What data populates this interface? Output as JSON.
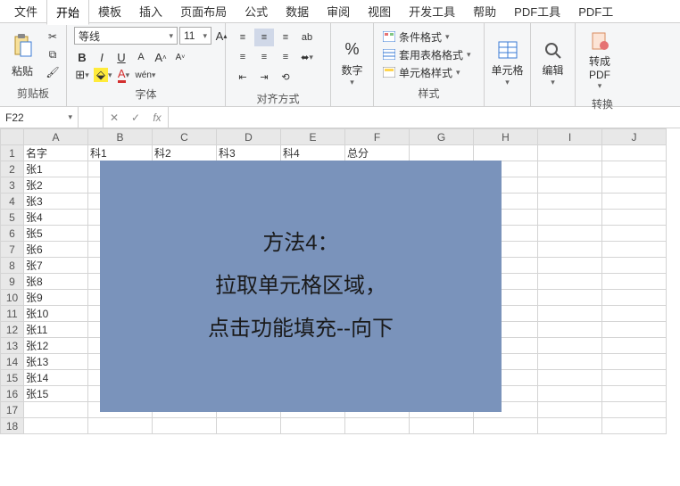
{
  "menu": {
    "items": [
      "文件",
      "开始",
      "模板",
      "插入",
      "页面布局",
      "公式",
      "数据",
      "审阅",
      "视图",
      "开发工具",
      "帮助",
      "PDF工具",
      "PDF工"
    ],
    "active": 1
  },
  "ribbon": {
    "clipboard": {
      "paste": "粘贴",
      "label": "剪贴板"
    },
    "font": {
      "name": "等线",
      "size": "11",
      "label": "字体"
    },
    "align": {
      "label": "对齐方式"
    },
    "number": {
      "btn": "数字",
      "label": ""
    },
    "styles": {
      "cond": "条件格式",
      "table": "套用表格格式",
      "cell": "单元格样式",
      "label": "样式"
    },
    "cells": {
      "btn": "单元格"
    },
    "edit": {
      "btn": "编辑"
    },
    "convert": {
      "btn": "转成PDF",
      "label": "转换"
    }
  },
  "fbar": {
    "name": "F22",
    "fx": "fx"
  },
  "cols": [
    "A",
    "B",
    "C",
    "D",
    "E",
    "F",
    "G",
    "H",
    "I",
    "J"
  ],
  "headers": {
    "A": "名字",
    "B": "科1",
    "C": "科2",
    "D": "科3",
    "E": "科4",
    "F": "总分"
  },
  "rows": [
    "张1",
    "张2",
    "张3",
    "张4",
    "张5",
    "张6",
    "张7",
    "张8",
    "张9",
    "张10",
    "张11",
    "张12",
    "张13",
    "张14",
    "张15"
  ],
  "overlay": {
    "l1": "方法4：",
    "l2": "拉取单元格区域，",
    "l3": "点击功能填充--向下"
  }
}
